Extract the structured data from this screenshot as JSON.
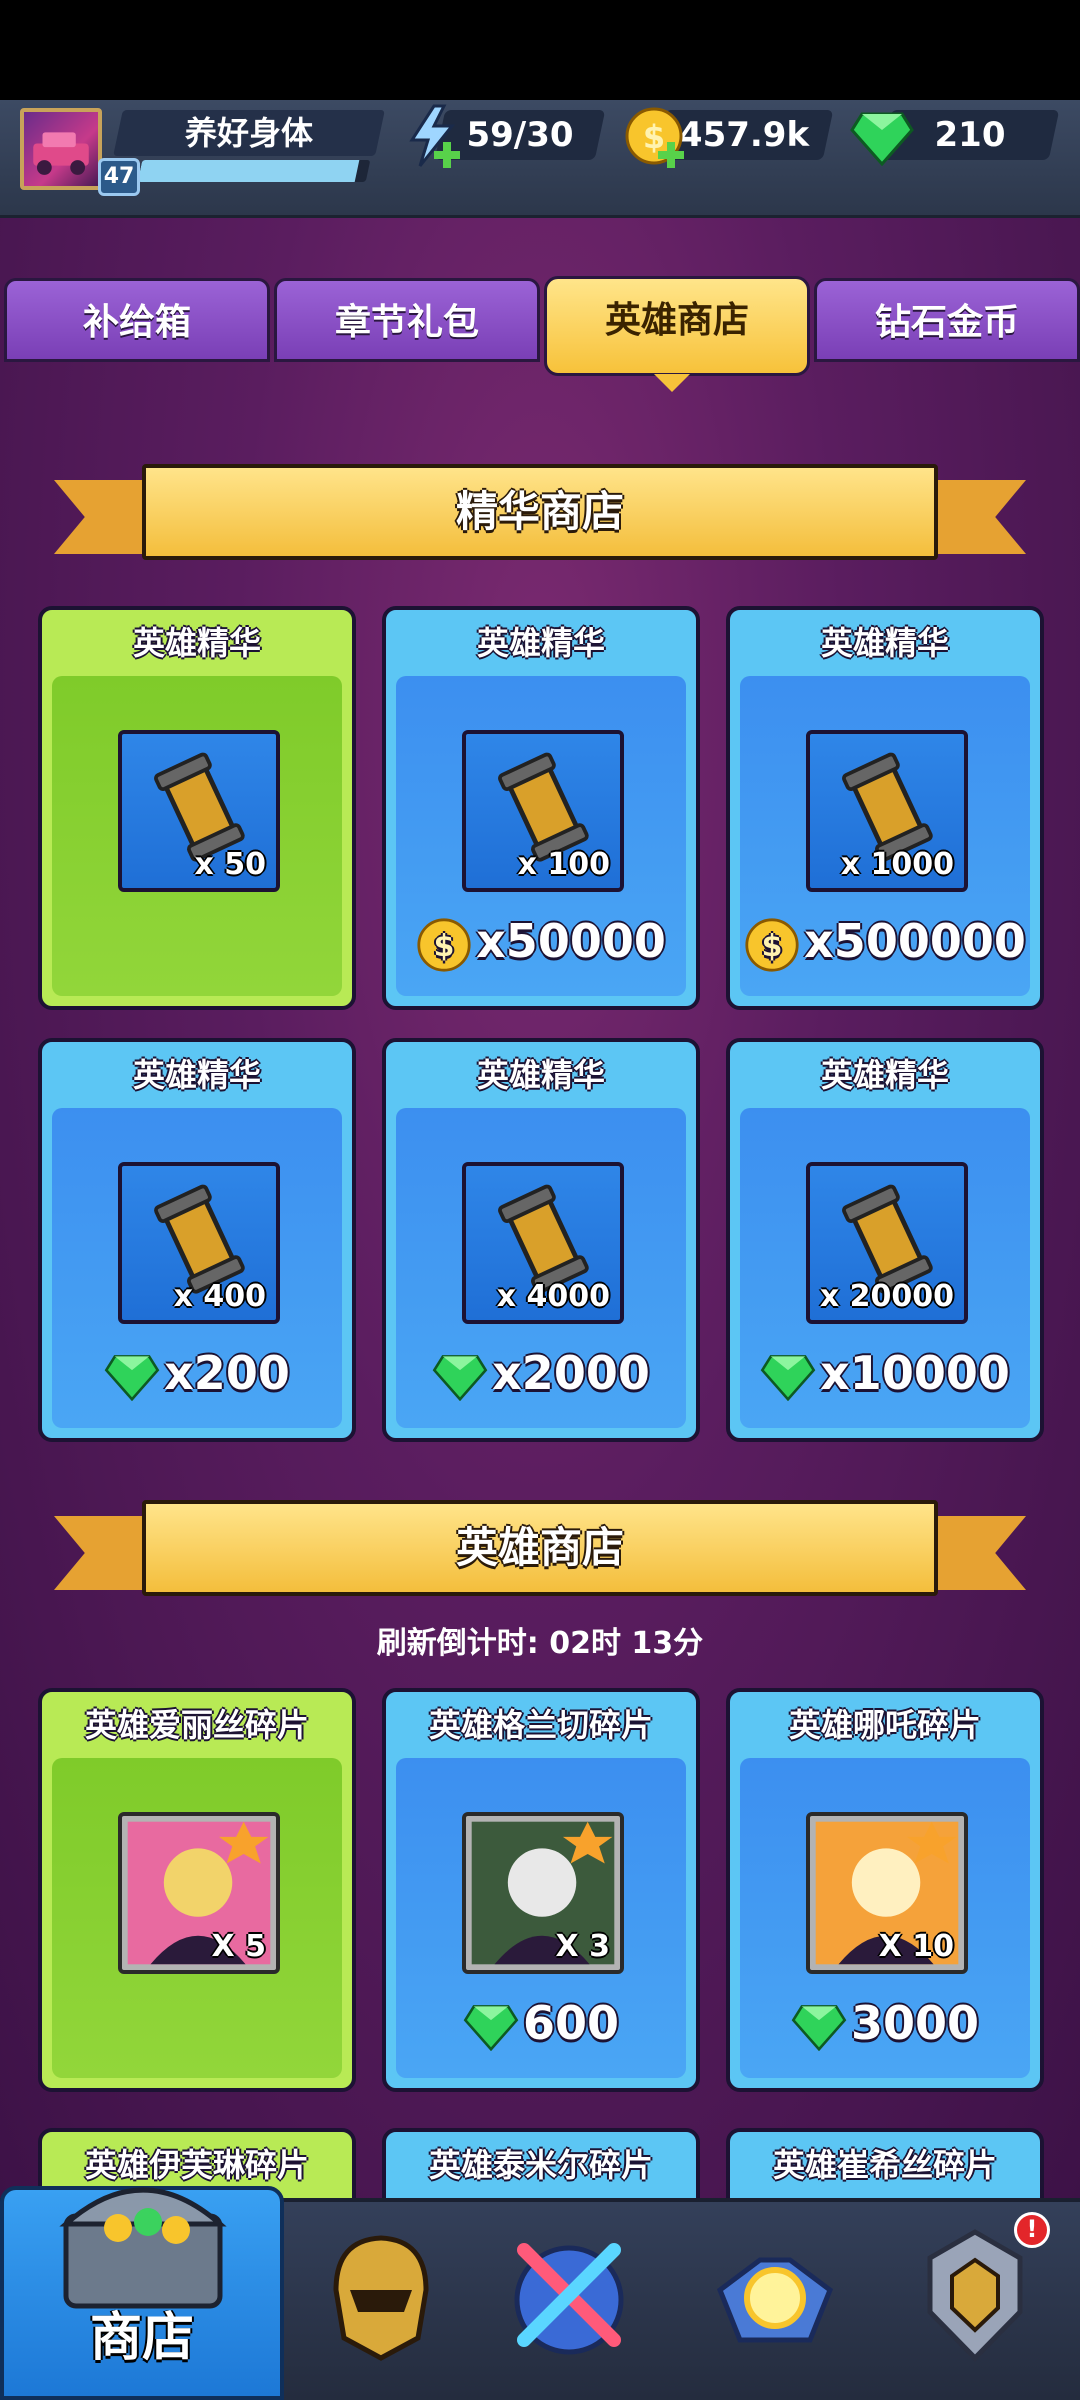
{
  "player": {
    "name": "养好身体",
    "level": "47",
    "xp_fraction": 0.95
  },
  "resources": {
    "energy": "59/30",
    "coins": "457.9k",
    "gems": "210"
  },
  "tabs": [
    {
      "label": "补给箱"
    },
    {
      "label": "章节礼包"
    },
    {
      "label": "英雄商店",
      "active": true
    },
    {
      "label": "钻石金币"
    }
  ],
  "essence_shop": {
    "title": "精华商店",
    "items": [
      {
        "name": "英雄精华",
        "qty": "x 50",
        "price": "",
        "currency": "none",
        "style": "green"
      },
      {
        "name": "英雄精华",
        "qty": "x 100",
        "price": "x50000",
        "currency": "coin",
        "style": "blue"
      },
      {
        "name": "英雄精华",
        "qty": "x 1000",
        "price": "x500000",
        "currency": "coin",
        "style": "blue"
      },
      {
        "name": "英雄精华",
        "qty": "x 400",
        "price": "x200",
        "currency": "gem",
        "style": "blue"
      },
      {
        "name": "英雄精华",
        "qty": "x 4000",
        "price": "x2000",
        "currency": "gem",
        "style": "blue"
      },
      {
        "name": "英雄精华",
        "qty": "x 20000",
        "price": "x10000",
        "currency": "gem",
        "style": "blue"
      }
    ]
  },
  "hero_shop": {
    "title": "英雄商店",
    "refresh_text": "刷新倒计时: 02时 13分",
    "items": [
      {
        "name": "英雄爱丽丝碎片",
        "qty": "X 5",
        "price": "",
        "currency": "none",
        "style": "green"
      },
      {
        "name": "英雄格兰切碎片",
        "qty": "X 3",
        "price": "600",
        "currency": "gem",
        "style": "blue"
      },
      {
        "name": "英雄哪吒碎片",
        "qty": "X 10",
        "price": "3000",
        "currency": "gem",
        "style": "blue"
      }
    ],
    "partial_items": [
      {
        "name": "英雄伊芙琳碎片"
      },
      {
        "name": "英雄泰米尔碎片"
      },
      {
        "name": "英雄崔希丝碎片"
      }
    ]
  },
  "bottom_nav": {
    "shop_label": "商店",
    "alert": "!"
  },
  "colors": {
    "accent_gold": "#f7c23a",
    "tab_purple": "#8a4fc7",
    "card_blue": "#4aa6f4",
    "card_green": "#92d63a"
  }
}
